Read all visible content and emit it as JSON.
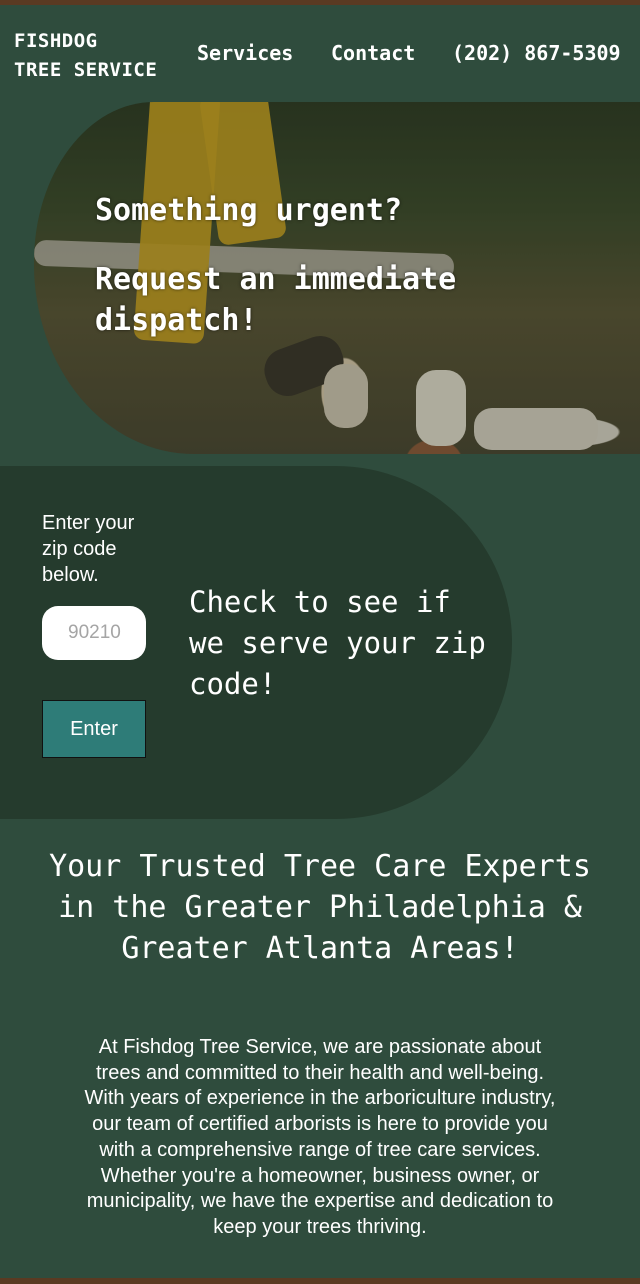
{
  "header": {
    "logo_line1": "FISHDOG",
    "logo_line2": "TREE SERVICE",
    "nav": {
      "services": "Services",
      "contact": "Contact",
      "phone": "(202) 867-5309"
    }
  },
  "hero": {
    "line1": "Something urgent?",
    "line2": "Request an immediate",
    "line3": "dispatch!"
  },
  "zip": {
    "label": "Enter your zip code below.",
    "placeholder": "90210",
    "button": "Enter",
    "cta": "Check to see if we serve your zip code!"
  },
  "main": {
    "heading": "Your Trusted Tree Care Experts in the Greater Philadelphia & Greater Atlanta Areas!",
    "intro": "At Fishdog Tree Service, we are passionate about trees and committed to their health and well-being. With years of experience in the arboriculture industry, our team of certified arborists is here to provide you with a comprehensive range of tree care services. Whether you're a homeowner, business owner, or municipality, we have the expertise and dedication to keep your trees thriving."
  },
  "colors": {
    "background": "#2f4c3d",
    "zip_panel": "#253b2d",
    "button": "#2e7c78",
    "border_brown": "#5a3a22"
  }
}
